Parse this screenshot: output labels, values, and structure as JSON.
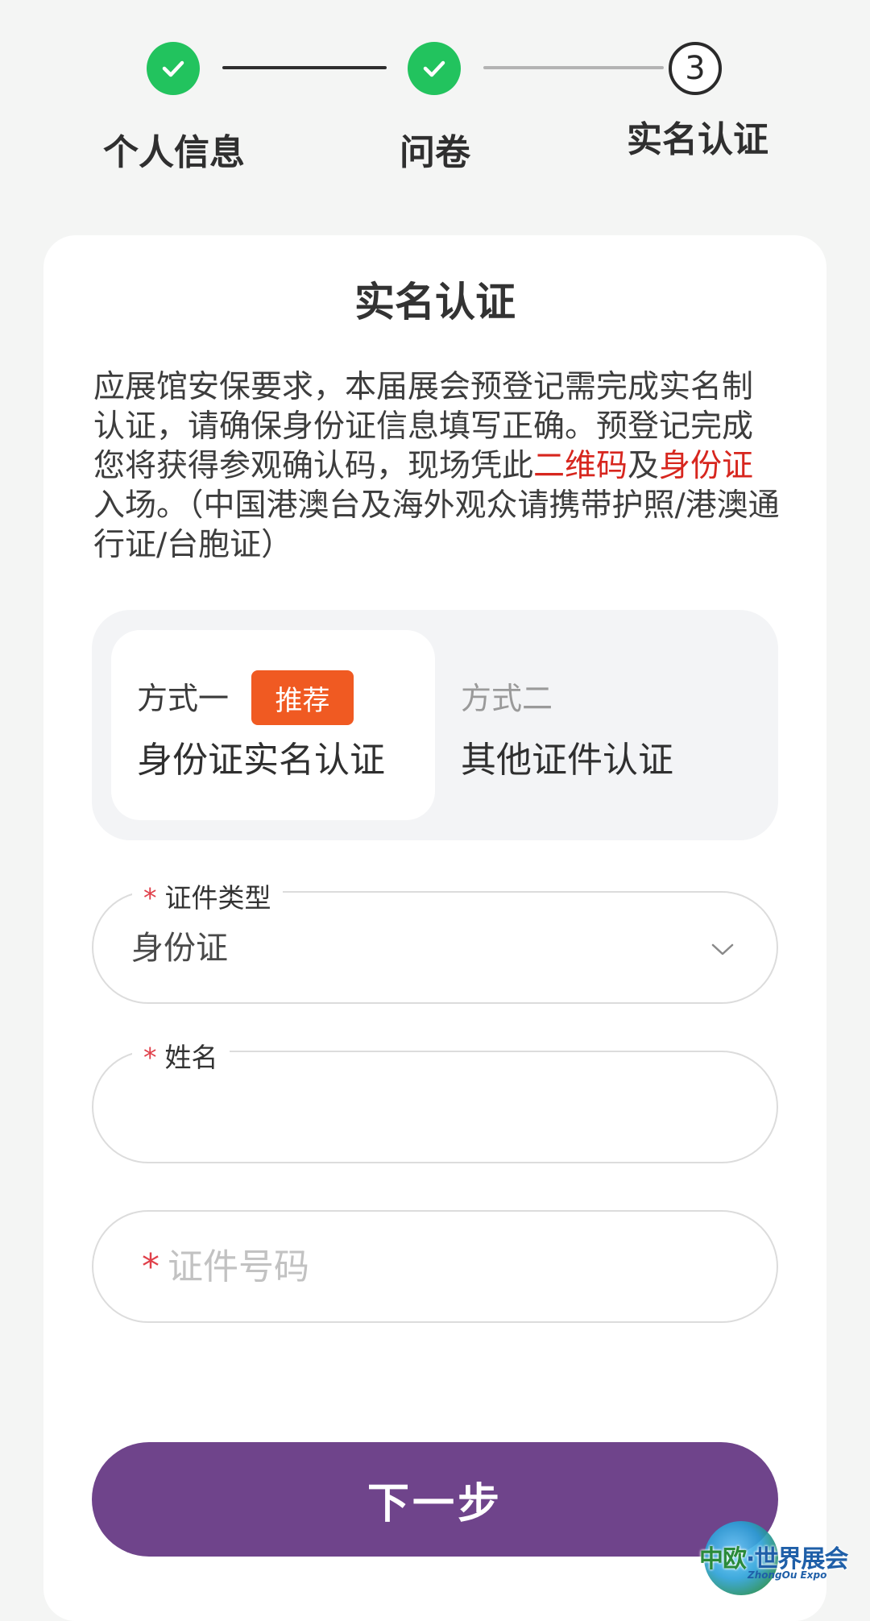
{
  "stepper": {
    "steps": [
      {
        "label": "个人信息",
        "status": "done"
      },
      {
        "label": "问卷",
        "status": "done"
      },
      {
        "label": "实名认证",
        "status": "current",
        "number": "3"
      }
    ]
  },
  "card": {
    "title": "实名认证",
    "notice": {
      "part1": "应展馆安保要求，本届展会预登记需完成实名制认证，请确保身份证信息填写正确。预登记完成您将获得参观确认码，现场凭此",
      "highlight1": "二维码",
      "part2": "及",
      "highlight2": "身份证",
      "part3": "入场。（中国港澳台及海外观众请携带护照/港澳通行证/台胞证）"
    },
    "methods": [
      {
        "tag": "方式一",
        "badge": "推荐",
        "name": "身份证实名认证",
        "selected": true
      },
      {
        "tag": "方式二",
        "name": "其他证件认证",
        "selected": false
      }
    ],
    "fields": {
      "doc_type": {
        "label": "证件类型",
        "required_mark": "*",
        "value": "身份证"
      },
      "name": {
        "label": "姓名",
        "required_mark": "*",
        "value": ""
      },
      "doc_number": {
        "placeholder": "证件号码",
        "required_mark": "*"
      }
    },
    "next_button": "下一步"
  },
  "watermark": {
    "text_a": "中欧",
    "text_b": "·世界展会",
    "sub": "ZhongOu Expo"
  },
  "colors": {
    "done_green": "#22c35e",
    "button_purple": "#6f448b",
    "badge_orange": "#f05a22",
    "highlight_red": "#d7261e",
    "required_red": "#e0404a"
  }
}
